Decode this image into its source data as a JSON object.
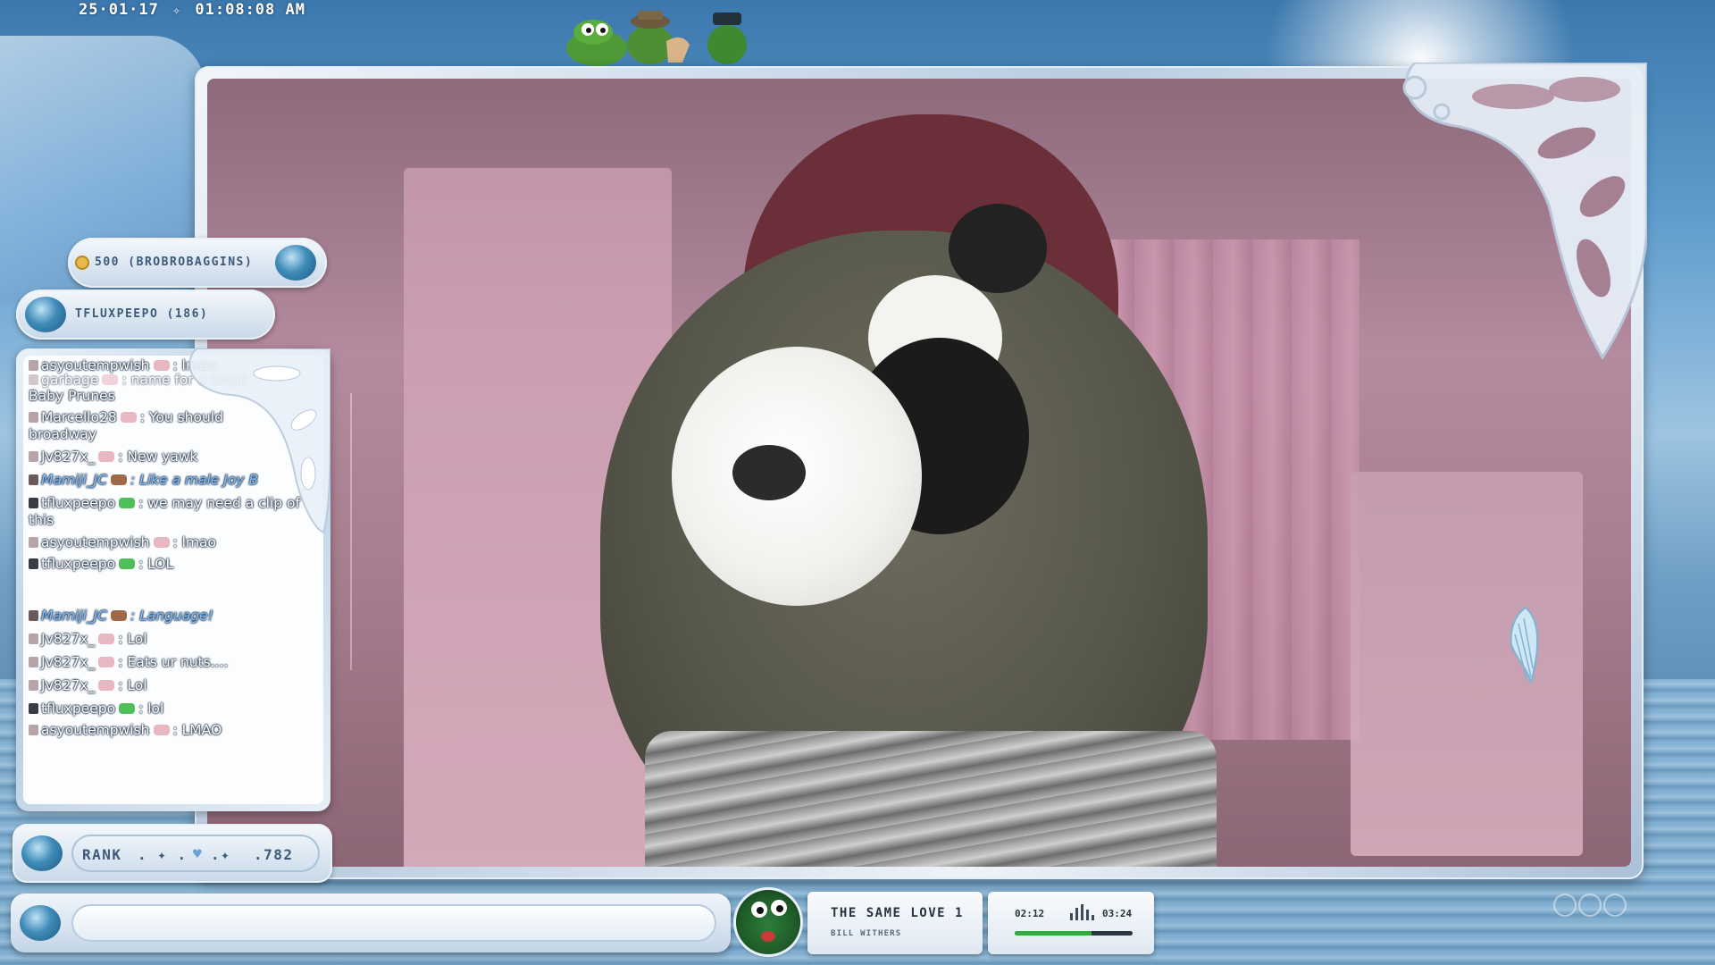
{
  "clock": {
    "date": "25·01·17",
    "time": "01:08:08 AM"
  },
  "goals": {
    "top_goal": "500 (BROBROBAGGINS)",
    "second_goal": "TFLUXPEEPO (186)"
  },
  "chat": {
    "messages": [
      {
        "user": "asyoutempwish",
        "text": "lmao",
        "badge": "plain"
      },
      {
        "user": "garbage",
        "text": "name for a singe",
        "badge": "plain",
        "partial": true
      },
      {
        "user": "",
        "text": "Baby Prunes",
        "badge": "none"
      },
      {
        "user": "Marcello28",
        "text": "You should",
        "cont": "broadway",
        "badge": "plain"
      },
      {
        "user": "Jv827x_",
        "text": "New yawk",
        "badge": "plain"
      },
      {
        "user": "Mamiji_JC",
        "text": "Like a male Joy B",
        "badge": "mod",
        "italic": true
      },
      {
        "user": "tfluxpeepo",
        "text": "we may need a clip of",
        "cont": "this",
        "badge": "dark"
      },
      {
        "user": "asyoutempwish",
        "text": "lmao",
        "badge": "plain"
      },
      {
        "user": "tfluxpeepo",
        "text": "LOL",
        "badge": "dark"
      },
      {
        "user": "Mamiji_JC",
        "text": "Language!",
        "badge": "mod",
        "italic": true
      },
      {
        "user": "Jv827x_",
        "text": "Lol",
        "badge": "plain"
      },
      {
        "user": "Jv827x_",
        "text": "Eats ur nuts....",
        "badge": "plain"
      },
      {
        "user": "Jv827x_",
        "text": "Lol",
        "badge": "plain"
      },
      {
        "user": "tfluxpeepo",
        "text": "lol",
        "badge": "dark"
      },
      {
        "user": "asyoutempwish",
        "text": "LMAO",
        "badge": "plain"
      }
    ]
  },
  "rank": {
    "label": "RANK",
    "value": ".782"
  },
  "chat_input": {
    "placeholder": ""
  },
  "now_playing": {
    "title": "THE SAME LOVE 1",
    "artist": "BILL WITHERS",
    "elapsed": "02:12",
    "duration": "03:24",
    "progress": 0.65
  },
  "colors": {
    "chat_outline": "#1d2f46",
    "italic_user": "#7fc0ff",
    "progress_fill": "#2fae3c",
    "frame_light": "#eef3f9"
  }
}
